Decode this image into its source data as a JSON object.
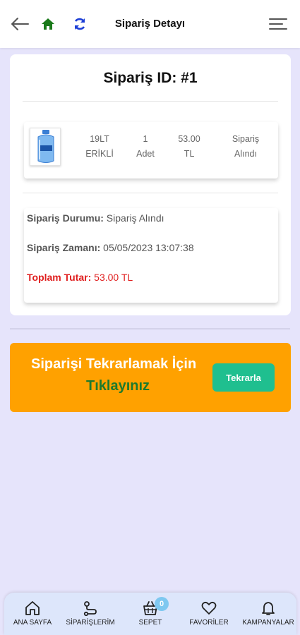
{
  "header": {
    "title": "Sipariş Detayı"
  },
  "order": {
    "id_label": "Sipariş ID: #1",
    "item": {
      "name_line1": "19LT",
      "name_line2": "ERİKLİ",
      "qty_line1": "1",
      "qty_line2": "Adet",
      "price_line1": "53.00",
      "price_line2": "TL",
      "state_line1": "Sipariş",
      "state_line2": "Alındı"
    },
    "status_label": "Sipariş Durumu:",
    "status_value": "Sipariş Alındı",
    "time_label": "Sipariş Zamanı:",
    "time_value": "05/05/2023 13:07:38",
    "total_label": "Toplam Tutar:",
    "total_value": "53.00 TL"
  },
  "repeat": {
    "line1": "Siparişi Tekrarlamak İçin",
    "line2": "Tıklayınız",
    "button": "Tekrarla"
  },
  "bottom_nav": {
    "home": "ANA SAYFA",
    "orders": "SİPARİŞLERİM",
    "cart": "SEPET",
    "cart_badge": "0",
    "favorites": "FAVORİLER",
    "campaigns": "KAMPANYALAR"
  },
  "colors": {
    "accent": "#ffa100",
    "button": "#1fbf8f",
    "total_red": "#e01f1f",
    "home_icon": "#1a7a1a",
    "refresh_icon": "#1d3fd6"
  }
}
